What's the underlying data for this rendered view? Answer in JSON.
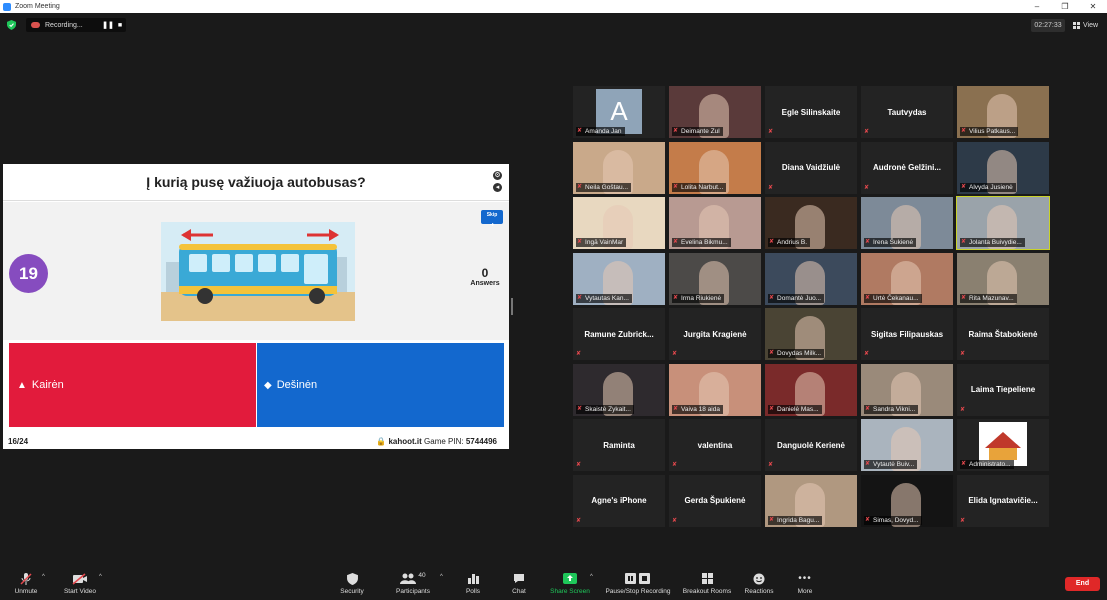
{
  "window": {
    "title": "Zoom Meeting",
    "controls": [
      "–",
      "❐",
      "✕"
    ]
  },
  "recording": {
    "label": "Recording...",
    "pause_icon": "pause-icon",
    "stop_icon": "stop-icon"
  },
  "meeting_timer": "02:27:33",
  "view_label": "View",
  "share": {
    "question": "Į kurią pusę važiuoja autobusas?",
    "skip_label": "Skip",
    "timer": "19",
    "answers_count": "0",
    "answers_label": "Answers",
    "answer_a": "Kairėn",
    "answer_b": "Dešinėn",
    "counter": "16/24",
    "site": "kahoot.it",
    "pin_label": "Game PIN:",
    "pin": "5744496"
  },
  "participants": [
    {
      "name": "Amanda Jan",
      "kind": "avatar",
      "avatar_letter": "A"
    },
    {
      "name": "Deimante Zul",
      "kind": "video",
      "bg": "#5a3a3a"
    },
    {
      "name": "Egle Silinskaite",
      "kind": "text"
    },
    {
      "name": "Tautvydas",
      "kind": "text"
    },
    {
      "name": "Vilius Patkaus...",
      "kind": "video",
      "bg": "#8a7050"
    },
    {
      "name": "Neila Goštau...",
      "kind": "video",
      "bg": "#c9a98a"
    },
    {
      "name": "Lolita Narbut...",
      "kind": "video",
      "bg": "#c47c4a"
    },
    {
      "name": "Diana Vaidžiulė",
      "kind": "text"
    },
    {
      "name": "Audronė  Gelžini...",
      "kind": "text"
    },
    {
      "name": "Alvyda Jusienė",
      "kind": "video",
      "bg": "#2d3a48"
    },
    {
      "name": "Ingā VainMar",
      "kind": "video",
      "bg": "#e8d8c0"
    },
    {
      "name": "Evelina Bikmu...",
      "kind": "video",
      "bg": "#b89a92"
    },
    {
      "name": "Andrius B.",
      "kind": "video",
      "bg": "#3a2a20"
    },
    {
      "name": "Irena Šukienė",
      "kind": "video",
      "bg": "#7d8a98"
    },
    {
      "name": "Jolanta Buivydie...",
      "kind": "video",
      "bg": "#9aa3aa",
      "active": true
    },
    {
      "name": "Vytautas Kan...",
      "kind": "video",
      "bg": "#9fb0c2"
    },
    {
      "name": "Irma Riukienė",
      "kind": "video",
      "bg": "#4c4a48"
    },
    {
      "name": "Domantė Juo...",
      "kind": "video",
      "bg": "#3c4a5c"
    },
    {
      "name": "Urtė Čekanau...",
      "kind": "video",
      "bg": "#b07a62"
    },
    {
      "name": "Rita Mazunav...",
      "kind": "video",
      "bg": "#8a8070"
    },
    {
      "name": "Ramune  Zubrick...",
      "kind": "text"
    },
    {
      "name": "Jurgita Kragienė",
      "kind": "text"
    },
    {
      "name": "Dovydas Milk...",
      "kind": "video",
      "bg": "#4a4434"
    },
    {
      "name": "Sigitas Filipauskas",
      "kind": "text"
    },
    {
      "name": "Raima Štabokienė",
      "kind": "text"
    },
    {
      "name": "Skaistė Zykait...",
      "kind": "video",
      "bg": "#2e2a2e"
    },
    {
      "name": "Vaiva 18 aida",
      "kind": "video",
      "bg": "#c8907a"
    },
    {
      "name": "Danielė Mas...",
      "kind": "video",
      "bg": "#7a2a2a"
    },
    {
      "name": "Sandra Vikni...",
      "kind": "video",
      "bg": "#9a8a7a"
    },
    {
      "name": "Laima Tiepeliene",
      "kind": "text"
    },
    {
      "name": "Raminta",
      "kind": "text"
    },
    {
      "name": "valentina",
      "kind": "text"
    },
    {
      "name": "Danguolė Kerienė",
      "kind": "text"
    },
    {
      "name": "Vytautė Buiv...",
      "kind": "video",
      "bg": "#aab4be"
    },
    {
      "name": "Administrato...",
      "kind": "logo"
    },
    {
      "name": "Agne's iPhone",
      "kind": "text"
    },
    {
      "name": "Gerda Špukienė",
      "kind": "text"
    },
    {
      "name": "Ingrida Bagu...",
      "kind": "video",
      "bg": "#b09880"
    },
    {
      "name": "Simas, Dovyd...",
      "kind": "video",
      "bg": "#141414"
    },
    {
      "name": "Elida  Ignatavičie...",
      "kind": "text"
    }
  ],
  "toolbar": {
    "unmute": "Unmute",
    "start_video": "Start Video",
    "security": "Security",
    "participants": "Participants",
    "participants_count": "40",
    "polls": "Polls",
    "chat": "Chat",
    "share_screen": "Share Screen",
    "pause_recording": "Pause/Stop Recording",
    "breakout": "Breakout Rooms",
    "reactions": "Reactions",
    "more": "More",
    "end": "End"
  },
  "colors": {
    "accent_green": "#1fc75a",
    "end_red": "#e02828",
    "kahoot_red": "#e21b3c",
    "kahoot_blue": "#1368ce",
    "timer_purple": "#864cbf"
  }
}
